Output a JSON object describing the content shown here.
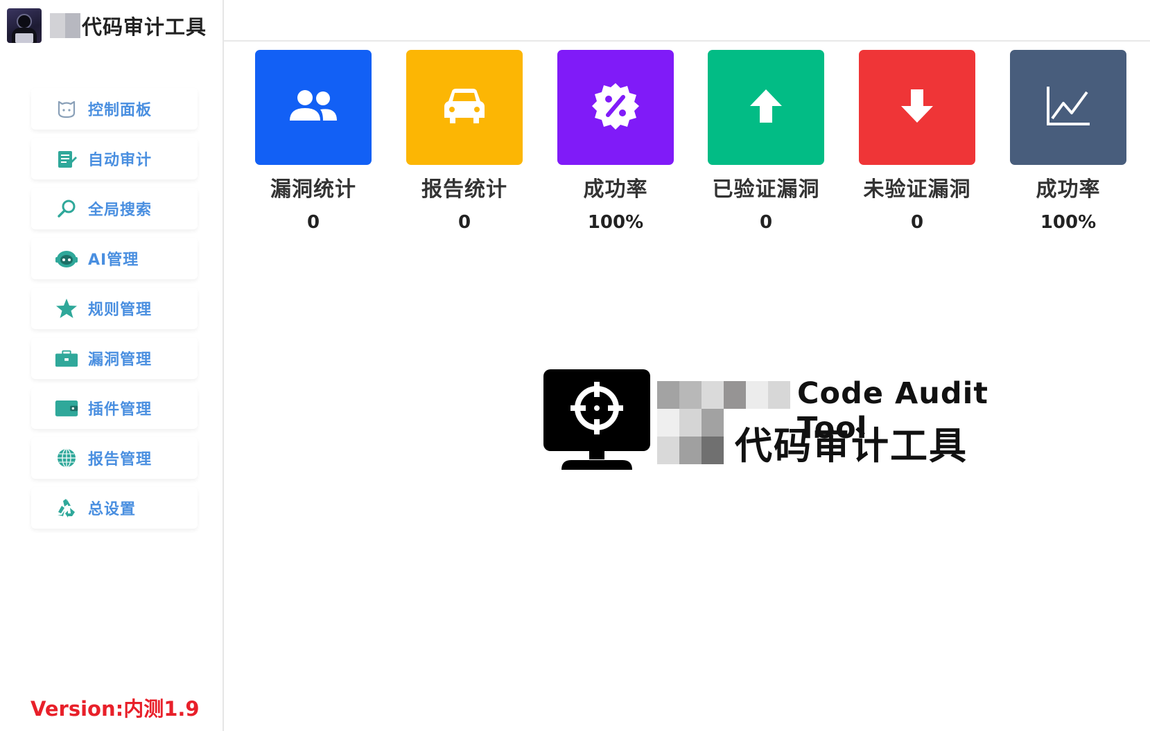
{
  "app": {
    "title": "代码审计工具",
    "version": "Version:内测1.9"
  },
  "sidebar": {
    "items": [
      {
        "label": "控制面板",
        "icon": "dashboard-icon"
      },
      {
        "label": "自动审计",
        "icon": "edit-document-icon"
      },
      {
        "label": "全局搜索",
        "icon": "search-icon"
      },
      {
        "label": "AI管理",
        "icon": "robot-icon"
      },
      {
        "label": "规则管理",
        "icon": "star-icon"
      },
      {
        "label": "漏洞管理",
        "icon": "briefcase-icon"
      },
      {
        "label": "插件管理",
        "icon": "wallet-icon"
      },
      {
        "label": "报告管理",
        "icon": "globe-icon"
      },
      {
        "label": "总设置",
        "icon": "recycle-icon"
      }
    ]
  },
  "stats": [
    {
      "label": "漏洞统计",
      "value": "0",
      "color": "#1260f5",
      "icon": "users-icon"
    },
    {
      "label": "报告统计",
      "value": "0",
      "color": "#fcb604",
      "icon": "car-icon"
    },
    {
      "label": "成功率",
      "value": "100%",
      "color": "#801bf8",
      "icon": "percent-badge-icon"
    },
    {
      "label": "已验证漏洞",
      "value": "0",
      "color": "#02bc85",
      "icon": "arrow-up-icon"
    },
    {
      "label": "未验证漏洞",
      "value": "0",
      "color": "#ef3537",
      "icon": "arrow-down-icon"
    },
    {
      "label": "成功率",
      "value": "100%",
      "color": "#485d7c",
      "icon": "line-chart-icon"
    }
  ],
  "logo": {
    "title_en": "Code Audit Tool",
    "title_cn": "代码审计工具",
    "icon": "target-monitor-icon"
  }
}
